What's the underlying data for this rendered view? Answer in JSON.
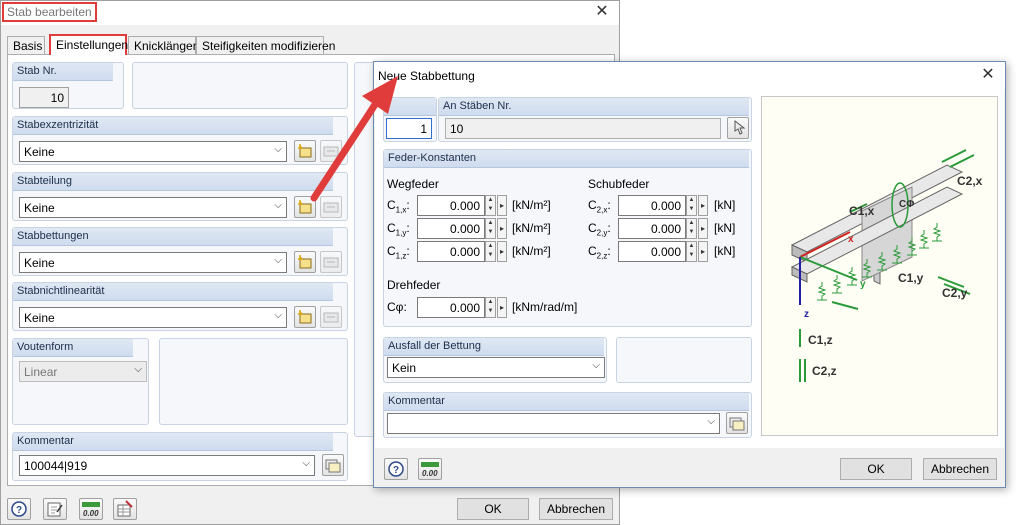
{
  "main_dialog": {
    "title": "Stab bearbeiten",
    "tabs": [
      "Basis",
      "Einstellungen",
      "Knicklängen",
      "Steifigkeiten modifizieren"
    ],
    "stab_nr_label": "Stab Nr.",
    "stab_nr_value": "10",
    "exzentrizitaet_label": "Stabexzentrizität",
    "exzentrizitaet_value": "Keine",
    "teilung_label": "Stabteilung",
    "teilung_value": "Keine",
    "bettungen_label": "Stabbettungen",
    "bettungen_value": "Keine",
    "nichtlinearitaet_label": "Stabnichtlinearität",
    "nichtlinearitaet_value": "Keine",
    "voutenform_label": "Voutenform",
    "voutenform_value": "Linear",
    "kommentar_label": "Kommentar",
    "kommentar_value": "100044|919",
    "ok_label": "OK",
    "cancel_label": "Abbrechen"
  },
  "sub_dialog": {
    "title": "Neue Stabbettung",
    "nr_value": "1",
    "an_staeben_label": "An Stäben Nr.",
    "an_staeben_value": "10",
    "feder_label": "Feder-Konstanten",
    "wegfeder_label": "Wegfeder",
    "schubfeder_label": "Schubfeder",
    "wegfeder_rows": [
      {
        "sym": "C",
        "sub": "1,x",
        "value": "0.000",
        "unit": "[kN/m²]"
      },
      {
        "sym": "C",
        "sub": "1,y",
        "value": "0.000",
        "unit": "[kN/m²]"
      },
      {
        "sym": "C",
        "sub": "1,z",
        "value": "0.000",
        "unit": "[kN/m²]"
      }
    ],
    "schubfeder_rows": [
      {
        "sym": "C",
        "sub": "2,x",
        "value": "0.000",
        "unit": "[kN]"
      },
      {
        "sym": "C",
        "sub": "2,y",
        "value": "0.000",
        "unit": "[kN]"
      },
      {
        "sym": "C",
        "sub": "2,z",
        "value": "0.000",
        "unit": "[kN]"
      }
    ],
    "drehfeder_label": "Drehfeder",
    "drehfeder_sym": "Cφ:",
    "drehfeder_value": "0.000",
    "drehfeder_unit": "[kNm/rad/m]",
    "ausfall_label": "Ausfall der Bettung",
    "ausfall_value": "Kein",
    "kommentar_label": "Kommentar",
    "kommentar_value": "",
    "ok_label": "OK",
    "cancel_label": "Abbrechen",
    "diagram_labels": {
      "c1x": "C1,x",
      "c2x": "C2,x",
      "cphi": "CΦ",
      "c1y": "C1,y",
      "c2y": "C2,y",
      "c1z": "C1,z",
      "c2z": "C2,z",
      "x": "x",
      "y": "y",
      "z": "z"
    }
  },
  "colors": {
    "highlight": "#e03c3c",
    "group_header": "#cfdcee",
    "spring": "#2a9a3a"
  }
}
